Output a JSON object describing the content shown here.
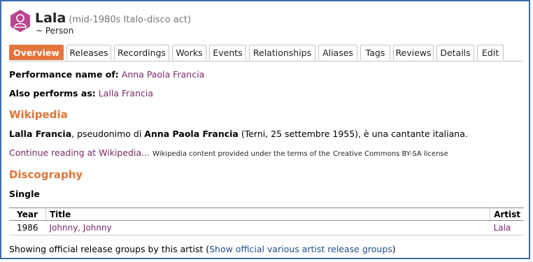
{
  "artist": {
    "name": "Lala",
    "disambiguation": "(mid-1980s Italo-disco act)",
    "type": "~ Person",
    "avatar_color": "#ba478f"
  },
  "tabs": [
    {
      "label": "Overview",
      "active": true
    },
    {
      "label": "Releases"
    },
    {
      "label": "Recordings"
    },
    {
      "label": "Works"
    },
    {
      "label": "Events"
    },
    {
      "label": "Relationships"
    },
    {
      "label": "Aliases"
    },
    {
      "label": "Tags"
    },
    {
      "label": "Reviews"
    },
    {
      "label": "Details"
    },
    {
      "label": "Edit"
    }
  ],
  "overview": {
    "performance_label": "Performance name of:",
    "performance_value": "Anna Paola Francia",
    "also_label": "Also performs as:",
    "also_value": "Lalla Francia"
  },
  "wikipedia": {
    "heading": "Wikipedia",
    "bold1": "Lalla Francia",
    "text1": ", pseudonimo di ",
    "bold2": "Anna Paola Francia",
    "text2": " (Terni, 25 settembre 1955), è una cantante italiana.",
    "continue_link": "Continue reading at Wikipedia...",
    "license_text": "Wikipedia content provided under the terms of the",
    "license_link": "Creative Commons BY-SA license"
  },
  "discography": {
    "heading": "Discography",
    "subheading": "Single",
    "columns": [
      "Year",
      "Title",
      "Artist"
    ],
    "rows": [
      {
        "year": "1986",
        "title": "Johnny, Johnny",
        "artist": "Lala"
      }
    ],
    "footer_text": "Showing official release groups by this artist (",
    "footer_link": "Show official various artist release groups",
    "footer_close": ")"
  },
  "colors": {
    "accent_orange": "#e5753c",
    "link_purple": "#7a2868",
    "link_blue": "#214d8d",
    "frame_border": "#3a6bb0"
  }
}
